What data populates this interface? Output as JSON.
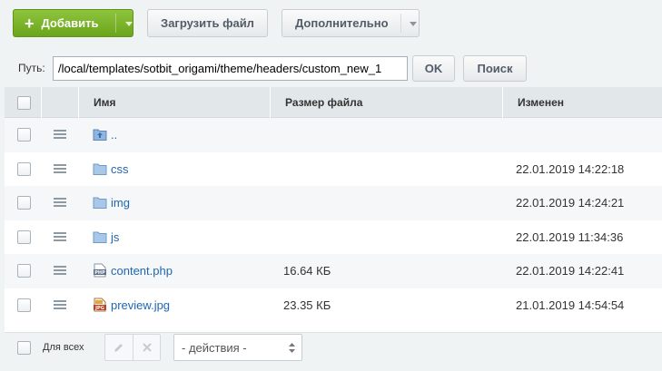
{
  "toolbar": {
    "add_label": "Добавить",
    "upload_label": "Загрузить файл",
    "more_label": "Дополнительно"
  },
  "pathbar": {
    "label": "Путь:",
    "value": "/local/templates/sotbit_origami/theme/headers/custom_new_1",
    "ok_label": "OK",
    "search_label": "Поиск"
  },
  "columns": {
    "name": "Имя",
    "size": "Размер файла",
    "modified": "Изменен"
  },
  "rows": [
    {
      "name": "..",
      "type": "up-folder",
      "size": "",
      "modified": ""
    },
    {
      "name": "css",
      "type": "folder",
      "size": "",
      "modified": "22.01.2019 14:22:18"
    },
    {
      "name": "img",
      "type": "folder",
      "size": "",
      "modified": "22.01.2019 14:24:21"
    },
    {
      "name": "js",
      "type": "folder",
      "size": "",
      "modified": "22.01.2019 11:34:36"
    },
    {
      "name": "content.php",
      "type": "php-file",
      "size": "16.64 КБ",
      "modified": "22.01.2019 14:22:41"
    },
    {
      "name": "preview.jpg",
      "type": "jpg-file",
      "size": "23.35 КБ",
      "modified": "21.01.2019 14:54:54"
    }
  ],
  "footer": {
    "for_all_label": "Для всех",
    "actions_selected": "- действия -"
  },
  "colors": {
    "add_button": "#7ab42a",
    "folder": "#7fa9d6",
    "link": "#2067b0",
    "header_bg": "#e2e7e9"
  }
}
